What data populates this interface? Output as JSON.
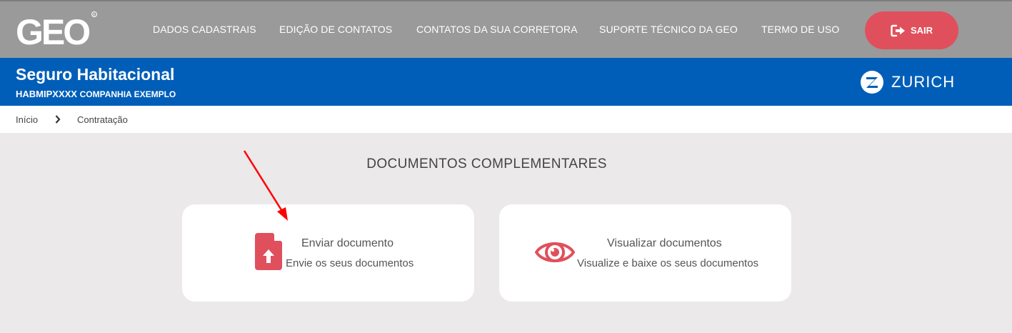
{
  "header": {
    "logo_text": "GEO",
    "nav": [
      "DADOS CADASTRAIS",
      "EDIÇÃO DE CONTATOS",
      "CONTATOS DA SUA CORRETORA",
      "SUPORTE TÉCNICO DA GEO",
      "TERMO DE USO"
    ],
    "logout_label": "SAIR",
    "logout_icon": "sign-out-icon"
  },
  "product": {
    "title": "Seguro Habitacional",
    "code": "HABMIPXXXX",
    "company": "COMPANHIA EXEMPLO",
    "insurer_logo": "ZURICH"
  },
  "breadcrumb": {
    "home": "Início",
    "current": "Contratação"
  },
  "main": {
    "section_title": "DOCUMENTOS COMPLEMENTARES",
    "cards": [
      {
        "title": "Enviar documento",
        "description": "Envie os seus documentos",
        "icon": "file-upload-icon"
      },
      {
        "title": "Visualizar documentos",
        "description": "Visualize e baixe os seus documentos",
        "icon": "eye-icon"
      }
    ]
  },
  "colors": {
    "header_gray": "#9a9a9a",
    "brand_blue": "#005eb8",
    "accent_red": "#e0505c",
    "content_bg": "#ebe9ea",
    "annotation_arrow": "#ff0000"
  }
}
